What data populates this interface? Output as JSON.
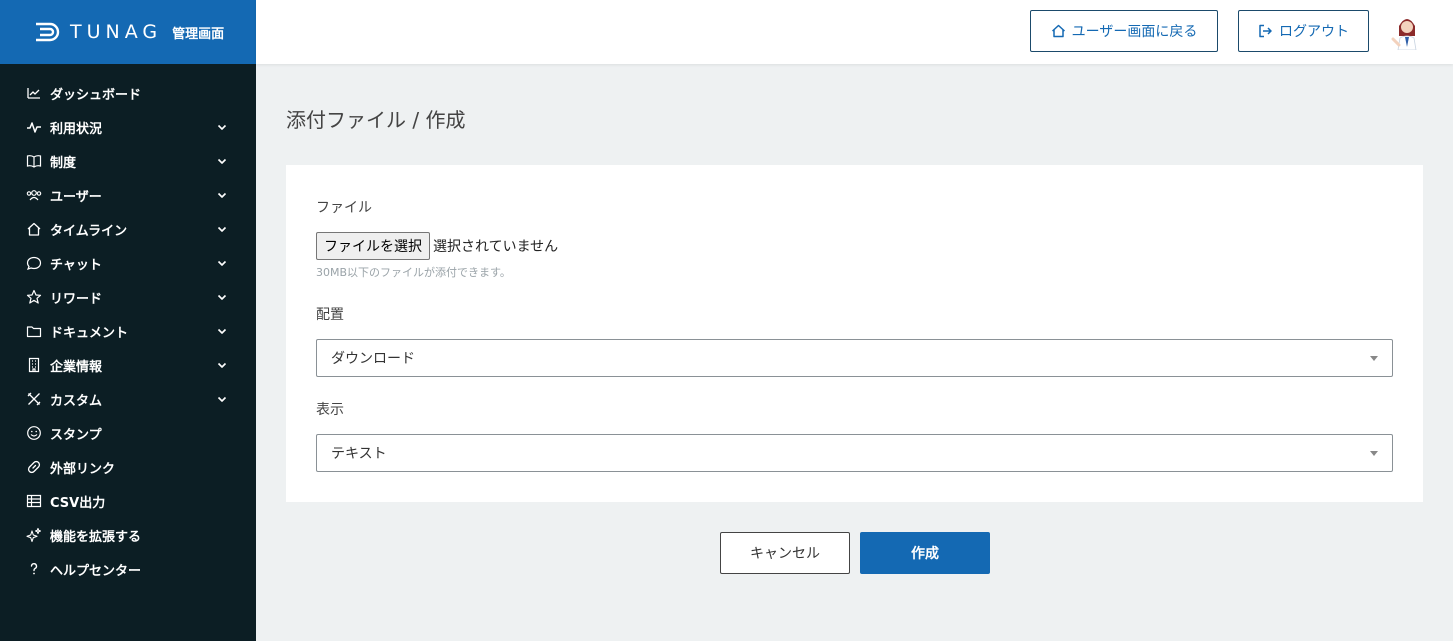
{
  "brand": {
    "logo": "TUNAG",
    "sub": "管理画面"
  },
  "sidebar": {
    "items": [
      {
        "label": "ダッシュボード",
        "icon": "chart-line-icon",
        "expandable": false
      },
      {
        "label": "利用状況",
        "icon": "pulse-icon",
        "expandable": true
      },
      {
        "label": "制度",
        "icon": "book-icon",
        "expandable": true
      },
      {
        "label": "ユーザー",
        "icon": "users-icon",
        "expandable": true
      },
      {
        "label": "タイムライン",
        "icon": "home-icon",
        "expandable": true
      },
      {
        "label": "チャット",
        "icon": "chat-icon",
        "expandable": true
      },
      {
        "label": "リワード",
        "icon": "star-icon",
        "expandable": true
      },
      {
        "label": "ドキュメント",
        "icon": "folder-icon",
        "expandable": true
      },
      {
        "label": "企業情報",
        "icon": "building-icon",
        "expandable": true
      },
      {
        "label": "カスタム",
        "icon": "tools-icon",
        "expandable": true
      },
      {
        "label": "スタンプ",
        "icon": "smile-icon",
        "expandable": false
      },
      {
        "label": "外部リンク",
        "icon": "link-icon",
        "expandable": false
      },
      {
        "label": "CSV出力",
        "icon": "table-icon",
        "expandable": false
      },
      {
        "label": "機能を拡張する",
        "icon": "sparkle-icon",
        "expandable": false
      },
      {
        "label": "ヘルプセンター",
        "icon": "help-icon",
        "expandable": false
      }
    ]
  },
  "header": {
    "user_screen_label": "ユーザー画面に戻る",
    "logout_label": "ログアウト"
  },
  "main": {
    "title": "添付ファイル / 作成",
    "file": {
      "label": "ファイル",
      "button_label": "ファイルを選択",
      "status": "選択されていません",
      "hint": "30MB以下のファイルが添付できます。"
    },
    "placement": {
      "label": "配置",
      "value": "ダウンロード"
    },
    "display": {
      "label": "表示",
      "value": "テキスト"
    },
    "cancel_label": "キャンセル",
    "create_label": "作成"
  },
  "colors": {
    "sidebar_bg": "#0c1e24",
    "brand_bg": "#1469b3",
    "accent": "#1469b3",
    "page_bg": "#eef1f2"
  }
}
